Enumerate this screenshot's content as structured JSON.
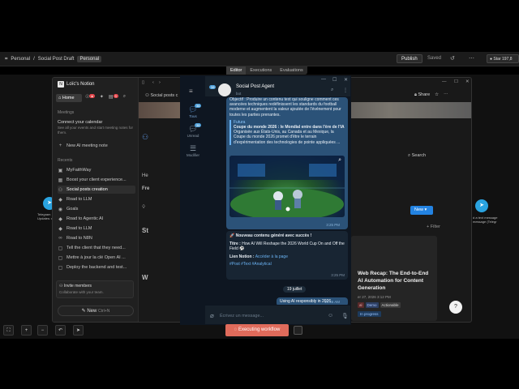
{
  "topbar": {
    "project": "Personal",
    "separator": "/",
    "workflow": "Social Post Draft",
    "tag": "Personal",
    "publish": "Publish",
    "saved": "Saved",
    "star": "Star",
    "star_count": "197,8"
  },
  "editor_tabs": [
    "Editor",
    "Executions",
    "Evaluations"
  ],
  "notion": {
    "workspace": "Loïc's Notion",
    "home": "Home",
    "inbox_badge": "3",
    "meetings_header": "Meetings",
    "calendar_title": "Connect your calendar",
    "calendar_sub": "See all your events and start meeting notes for them.",
    "new_meeting": "New AI meeting note",
    "recents_header": "Recents",
    "recents": [
      "MyFaithWay",
      "Boost your client experience...",
      "Social posts creation",
      "Road to LLM",
      "Goals",
      "Road to Agentic AI",
      "Road to LLM",
      "Road to N8N",
      "Tell the client that they need...",
      "Mettre à jour la clé Open AI ...",
      "Deploy the backend and test..."
    ],
    "invite_title": "Invite members",
    "invite_sub": "Collaborate with your team.",
    "new_button": "New",
    "new_shortcut": "Ctrl+N",
    "page_tab": "Social posts c",
    "share": "Share",
    "search": "Search",
    "new_db_button": "New",
    "filter": "Filter",
    "fragments": [
      "He",
      "Fre",
      "St",
      "W"
    ],
    "card": {
      "title": "Web Recap: The End-to-End AI Automation for Content Generation",
      "date": "er 27, 2026 3:12 PM",
      "tags": [
        "al",
        "Demo",
        "Actionable"
      ],
      "status": "In progress"
    }
  },
  "telegram": {
    "chat_name": "Social Post Agent",
    "chat_sub": "bot",
    "back_badge": "38",
    "folders": [
      {
        "label": "Tous",
        "count": "36"
      },
      {
        "label": "Unread",
        "count": "36"
      },
      {
        "label": "Modifier",
        "count": ""
      }
    ],
    "msg1_text": "Objectif : Produire un contenu text qui souligne comment ces avancées techniques redéfinissent les standards du football moderne et augmentent la valeur ajoutée de l'événement pour toutes les parties prenantes.",
    "msg1_quote_title": "Futura",
    "msg1_quote_headline": "Coupe du monde 2026 : le Mondial entre dans l'ère de l'IA",
    "msg1_quote_body": "Organisée aux États-Unis, au Canada et au Mexique, la Coupe du monde 2026 promet d'être le terrain d'expérimentation des technologies de pointe appliquées ...",
    "msg1_time": "3:25 PM",
    "msg2_head": "🚀 Nouveau contenu généré avec succès !",
    "msg2_title_label": "Titre :",
    "msg2_title": "How AI Will Reshape the 2026 World Cup On and Off the Field ⚽",
    "msg2_link_label": "Lien Notion :",
    "msg2_link": "Accéder à la page",
    "msg2_tags": "#Post #Text #Analytical",
    "msg2_time": "3:25 PM",
    "date_pill": "19 juillet",
    "msg3": "Using AI responsibly in 2026",
    "msg3_time": "10:46 AM",
    "placeholder": "Écrivez un message..."
  },
  "canvas": {
    "left_node_label": "Telegram",
    "left_node_sub": "Updates: m",
    "right_node_label": "d a text message",
    "right_node_sub": "message (Telegr"
  },
  "bottombar": {
    "executing": "Executing workflow"
  },
  "colors": {
    "telegram_bubble_out": "#2b5278",
    "telegram_bg": "#0e1621",
    "notion_blue": "#2383e2",
    "execute_red": "#e06b5b"
  }
}
